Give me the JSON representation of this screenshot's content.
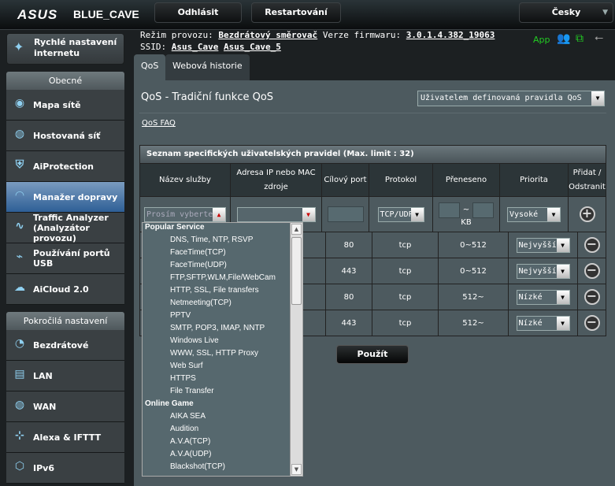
{
  "header": {
    "logo": "ASUS",
    "model": "BLUE_CAVE",
    "logout": "Odhlásit",
    "reboot": "Restartování",
    "language": "Česky"
  },
  "info": {
    "mode_label": "Režim provozu:",
    "mode_value": "Bezdrátový směrovač",
    "fw_label": "Verze firmwaru:",
    "fw_value": "3.0.1.4.382_19063",
    "ssid_label": "SSID:",
    "ssid1": "Asus_Cave",
    "ssid2": "Asus_Cave_5",
    "app": "App"
  },
  "sidebar": {
    "quick_setup": "Rychlé nastavení internetu",
    "general": "Obecné",
    "advanced": "Pokročilá nastavení",
    "general_items": [
      {
        "label": "Mapa sítě",
        "icon": "network-map-icon"
      },
      {
        "label": "Hostovaná síť",
        "icon": "globe-icon"
      },
      {
        "label": "AiProtection",
        "icon": "shield-icon"
      },
      {
        "label": "Manažer dopravy",
        "icon": "speedometer-icon",
        "active": true
      },
      {
        "label": "Traffic Analyzer (Analyzátor provozu)",
        "icon": "pulse-icon"
      },
      {
        "label": "Používání portů USB",
        "icon": "usb-icon"
      },
      {
        "label": "AiCloud 2.0",
        "icon": "cloud-icon"
      }
    ],
    "advanced_items": [
      {
        "label": "Bezdrátové",
        "icon": "wireless-icon"
      },
      {
        "label": "LAN",
        "icon": "lan-icon"
      },
      {
        "label": "WAN",
        "icon": "globe-icon"
      },
      {
        "label": "Alexa & IFTTT",
        "icon": "alexa-icon"
      },
      {
        "label": "IPv6",
        "icon": "ipv6-icon"
      }
    ]
  },
  "tabs": [
    {
      "label": "QoS",
      "active": true
    },
    {
      "label": "Webová historie"
    }
  ],
  "main": {
    "title": "QoS - Tradiční funkce QoS",
    "mode_select": "Uživatelem definovaná pravidla QoS",
    "faq": "QoS FAQ",
    "apply": "Použít"
  },
  "table": {
    "caption": "Seznam specifických uživatelských pravidel (Max. limit : 32)",
    "headers": [
      "Název služby",
      "Adresa IP nebo MAC zdroje",
      "Cílový port",
      "Protokol",
      "Přeneseno",
      "Priorita",
      "Přidat / Odstranit"
    ],
    "input": {
      "service_placeholder": "Prosím vyberte",
      "protocol": "TCP/UDP",
      "unit": "KB",
      "tilde": "~",
      "priority": "Vysoké"
    },
    "rows": [
      {
        "port": "80",
        "proto": "tcp",
        "transfer": "0~512",
        "priority": "Nejvyšší"
      },
      {
        "port": "443",
        "proto": "tcp",
        "transfer": "0~512",
        "priority": "Nejvyšší"
      },
      {
        "port": "80",
        "proto": "tcp",
        "transfer": "512~",
        "priority": "Nízké"
      },
      {
        "port": "443",
        "proto": "tcp",
        "transfer": "512~",
        "priority": "Nízké"
      }
    ]
  },
  "service_list": [
    {
      "label": "Popular Service",
      "group": true
    },
    {
      "label": "DNS, Time, NTP, RSVP"
    },
    {
      "label": "FaceTime(TCP)"
    },
    {
      "label": "FaceTime(UDP)"
    },
    {
      "label": "FTP,SFTP,WLM,File/WebCam"
    },
    {
      "label": "HTTP, SSL, File transfers"
    },
    {
      "label": "Netmeeting(TCP)"
    },
    {
      "label": "PPTV"
    },
    {
      "label": "SMTP, POP3, IMAP, NNTP"
    },
    {
      "label": "Windows Live"
    },
    {
      "label": "WWW, SSL, HTTP Proxy"
    },
    {
      "label": "Web Surf"
    },
    {
      "label": "HTTPS"
    },
    {
      "label": "File Transfer"
    },
    {
      "label": "Online Game",
      "group": true
    },
    {
      "label": "AIKA SEA"
    },
    {
      "label": "Audition"
    },
    {
      "label": "A.V.A(TCP)"
    },
    {
      "label": "A.V.A(UDP)"
    },
    {
      "label": "Blackshot(TCP)"
    }
  ],
  "colors": {
    "accent_active": "#2e5f96",
    "status_green": "#22cc22",
    "panel": "#4d5a5f"
  }
}
